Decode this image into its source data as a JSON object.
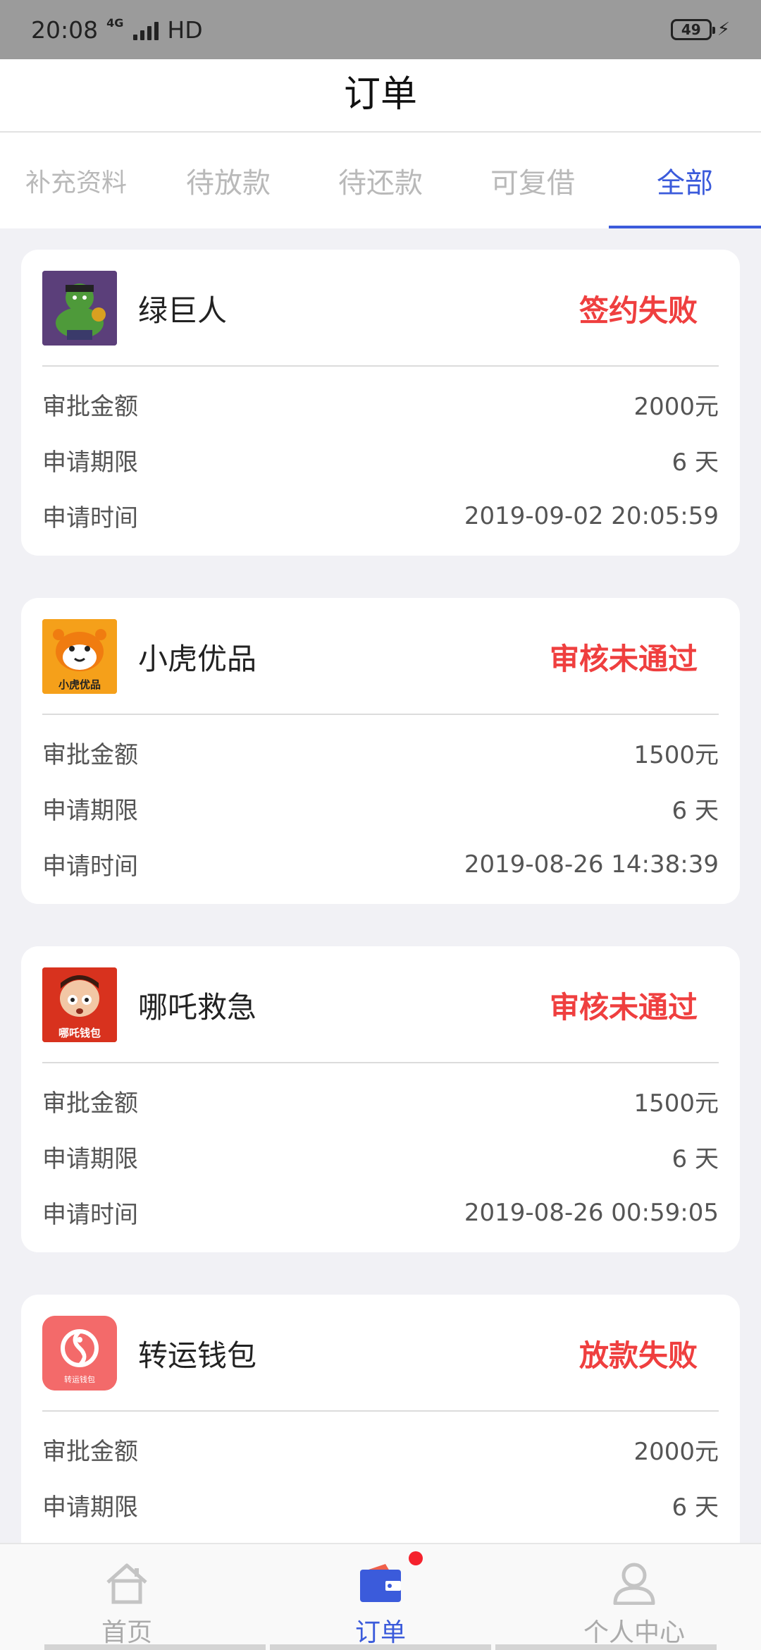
{
  "status_bar": {
    "time": "20:08",
    "network": "4G",
    "hd": "HD",
    "battery": "49"
  },
  "header": {
    "title": "订单"
  },
  "tabs": [
    {
      "label": "补充资料"
    },
    {
      "label": "待放款"
    },
    {
      "label": "待还款"
    },
    {
      "label": "可复借"
    },
    {
      "label": "全部"
    }
  ],
  "orders": [
    {
      "name": "绿巨人",
      "status": "签约失败",
      "rows": [
        {
          "label": "审批金额",
          "value": "2000元"
        },
        {
          "label": "申请期限",
          "value": "6 天"
        },
        {
          "label": "申请时间",
          "value": "2019-09-02 20:05:59"
        }
      ]
    },
    {
      "name": "小虎优品",
      "status": "审核未通过",
      "logo_text": "小虎优品",
      "rows": [
        {
          "label": "审批金额",
          "value": "1500元"
        },
        {
          "label": "申请期限",
          "value": "6 天"
        },
        {
          "label": "申请时间",
          "value": "2019-08-26 14:38:39"
        }
      ]
    },
    {
      "name": "哪吒救急",
      "status": "审核未通过",
      "logo_text": "哪吒钱包",
      "rows": [
        {
          "label": "审批金额",
          "value": "1500元"
        },
        {
          "label": "申请期限",
          "value": "6 天"
        },
        {
          "label": "申请时间",
          "value": "2019-08-26 00:59:05"
        }
      ]
    },
    {
      "name": "转运钱包",
      "status": "放款失败",
      "logo_text": "转运钱包",
      "rows": [
        {
          "label": "审批金额",
          "value": "2000元"
        },
        {
          "label": "申请期限",
          "value": "6 天"
        }
      ]
    }
  ],
  "bottom_nav": [
    {
      "label": "首页",
      "icon": "home-icon"
    },
    {
      "label": "订单",
      "icon": "wallet-icon"
    },
    {
      "label": "个人中心",
      "icon": "user-icon"
    }
  ],
  "colors": {
    "accent": "#3b5bdb",
    "status_red": "#ef3f3f",
    "background": "#f1f1f5"
  }
}
